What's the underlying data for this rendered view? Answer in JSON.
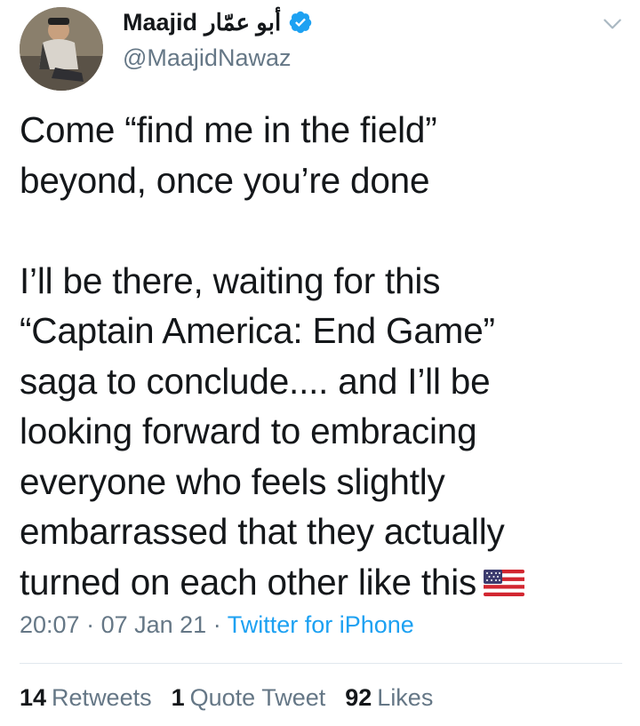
{
  "author": {
    "display_name": "Maajid",
    "arabic_name": "أبو عمّار",
    "handle": "@MaajidNawaz",
    "verified": true
  },
  "tweet": {
    "text": "Come “find me in the field”\nbeyond, once you’re done\n\nI’ll be there, waiting for this\n“Captain America: End Game”\nsaga to conclude.... and I’ll be\nlooking forward to embracing\neveryone who feels slightly\nembarrassed that they actually\nturned on each other like this",
    "emoji": "us-flag"
  },
  "meta": {
    "time": "20:07",
    "separator1": " · ",
    "date": "07 Jan 21",
    "separator2": " · ",
    "source": "Twitter for iPhone"
  },
  "stats": {
    "retweets_count": "14",
    "retweets_label": "Retweets",
    "quotes_count": "1",
    "quotes_label": "Quote Tweet",
    "likes_count": "92",
    "likes_label": "Likes"
  },
  "colors": {
    "verified": "#1da1f2",
    "link": "#1da1f2",
    "secondary_text": "#657786"
  }
}
